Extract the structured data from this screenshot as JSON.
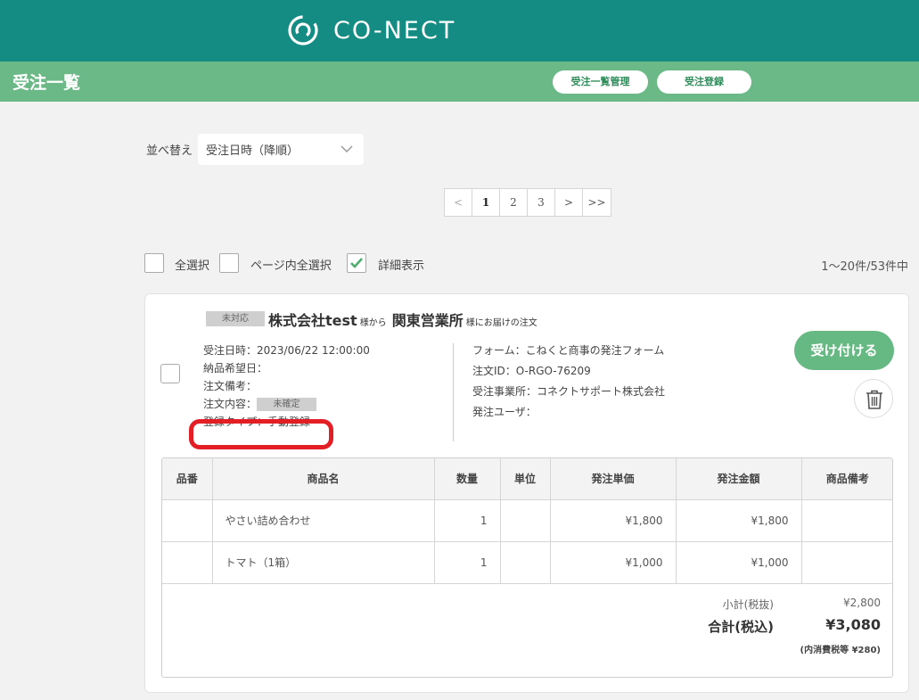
{
  "header": {
    "logo_text": "CO-NECT",
    "brand_color": "#148c83",
    "subbar_color": "#6bb986"
  },
  "subbar": {
    "title": "受注一覧",
    "manage_button": "受注一覧管理",
    "register_button": "受注登録"
  },
  "sort": {
    "label": "並べ替え",
    "selected": "受注日時（降順）"
  },
  "pagination": {
    "prev": "<",
    "pages": [
      "1",
      "2",
      "3"
    ],
    "active": "1",
    "next": ">",
    "last": ">>"
  },
  "selection": {
    "select_all": "全選択",
    "select_page": "ページ内全選択",
    "show_details": "詳細表示",
    "show_details_checked": true,
    "count_text": "1〜20件/53件中"
  },
  "order": {
    "status": "未対応",
    "customer": "株式会社test",
    "from_suffix": "様から",
    "destination": "関東営業所",
    "dest_suffix": "様にお届けの注文",
    "order_date": "受注日時：2023/06/22 12:00:00",
    "delivery_date": "納品希望日：",
    "order_note": "注文備考：",
    "content_label": "注文内容：",
    "content_badge": "未確定",
    "register_type": "登録タイプ：手動登録",
    "form": "フォーム：こねくと商事の発注フォーム",
    "order_id": "注文ID：O-RGO-76209",
    "office": "受注事業所：コネクトサポート株式会社",
    "order_user": "発注ユーザ：",
    "accept_button": "受け付ける",
    "highlight_color": "#e31e24"
  },
  "table": {
    "headers": [
      "品番",
      "商品名",
      "数量",
      "単位",
      "発注単価",
      "発注金額",
      "商品備考"
    ],
    "rows": [
      {
        "code": "",
        "name": "やさい詰め合わせ",
        "qty": "1",
        "unit": "",
        "price": "¥1,800",
        "amount": "¥1,800",
        "note": ""
      },
      {
        "code": "",
        "name": "トマト（1箱）",
        "qty": "1",
        "unit": "",
        "price": "¥1,000",
        "amount": "¥1,000",
        "note": ""
      }
    ],
    "subtotal_label": "小計(税抜)",
    "subtotal_value": "¥2,800",
    "total_label": "合計(税込)",
    "total_value": "¥3,080",
    "tax_note": "(内消費税等 ¥280)"
  }
}
